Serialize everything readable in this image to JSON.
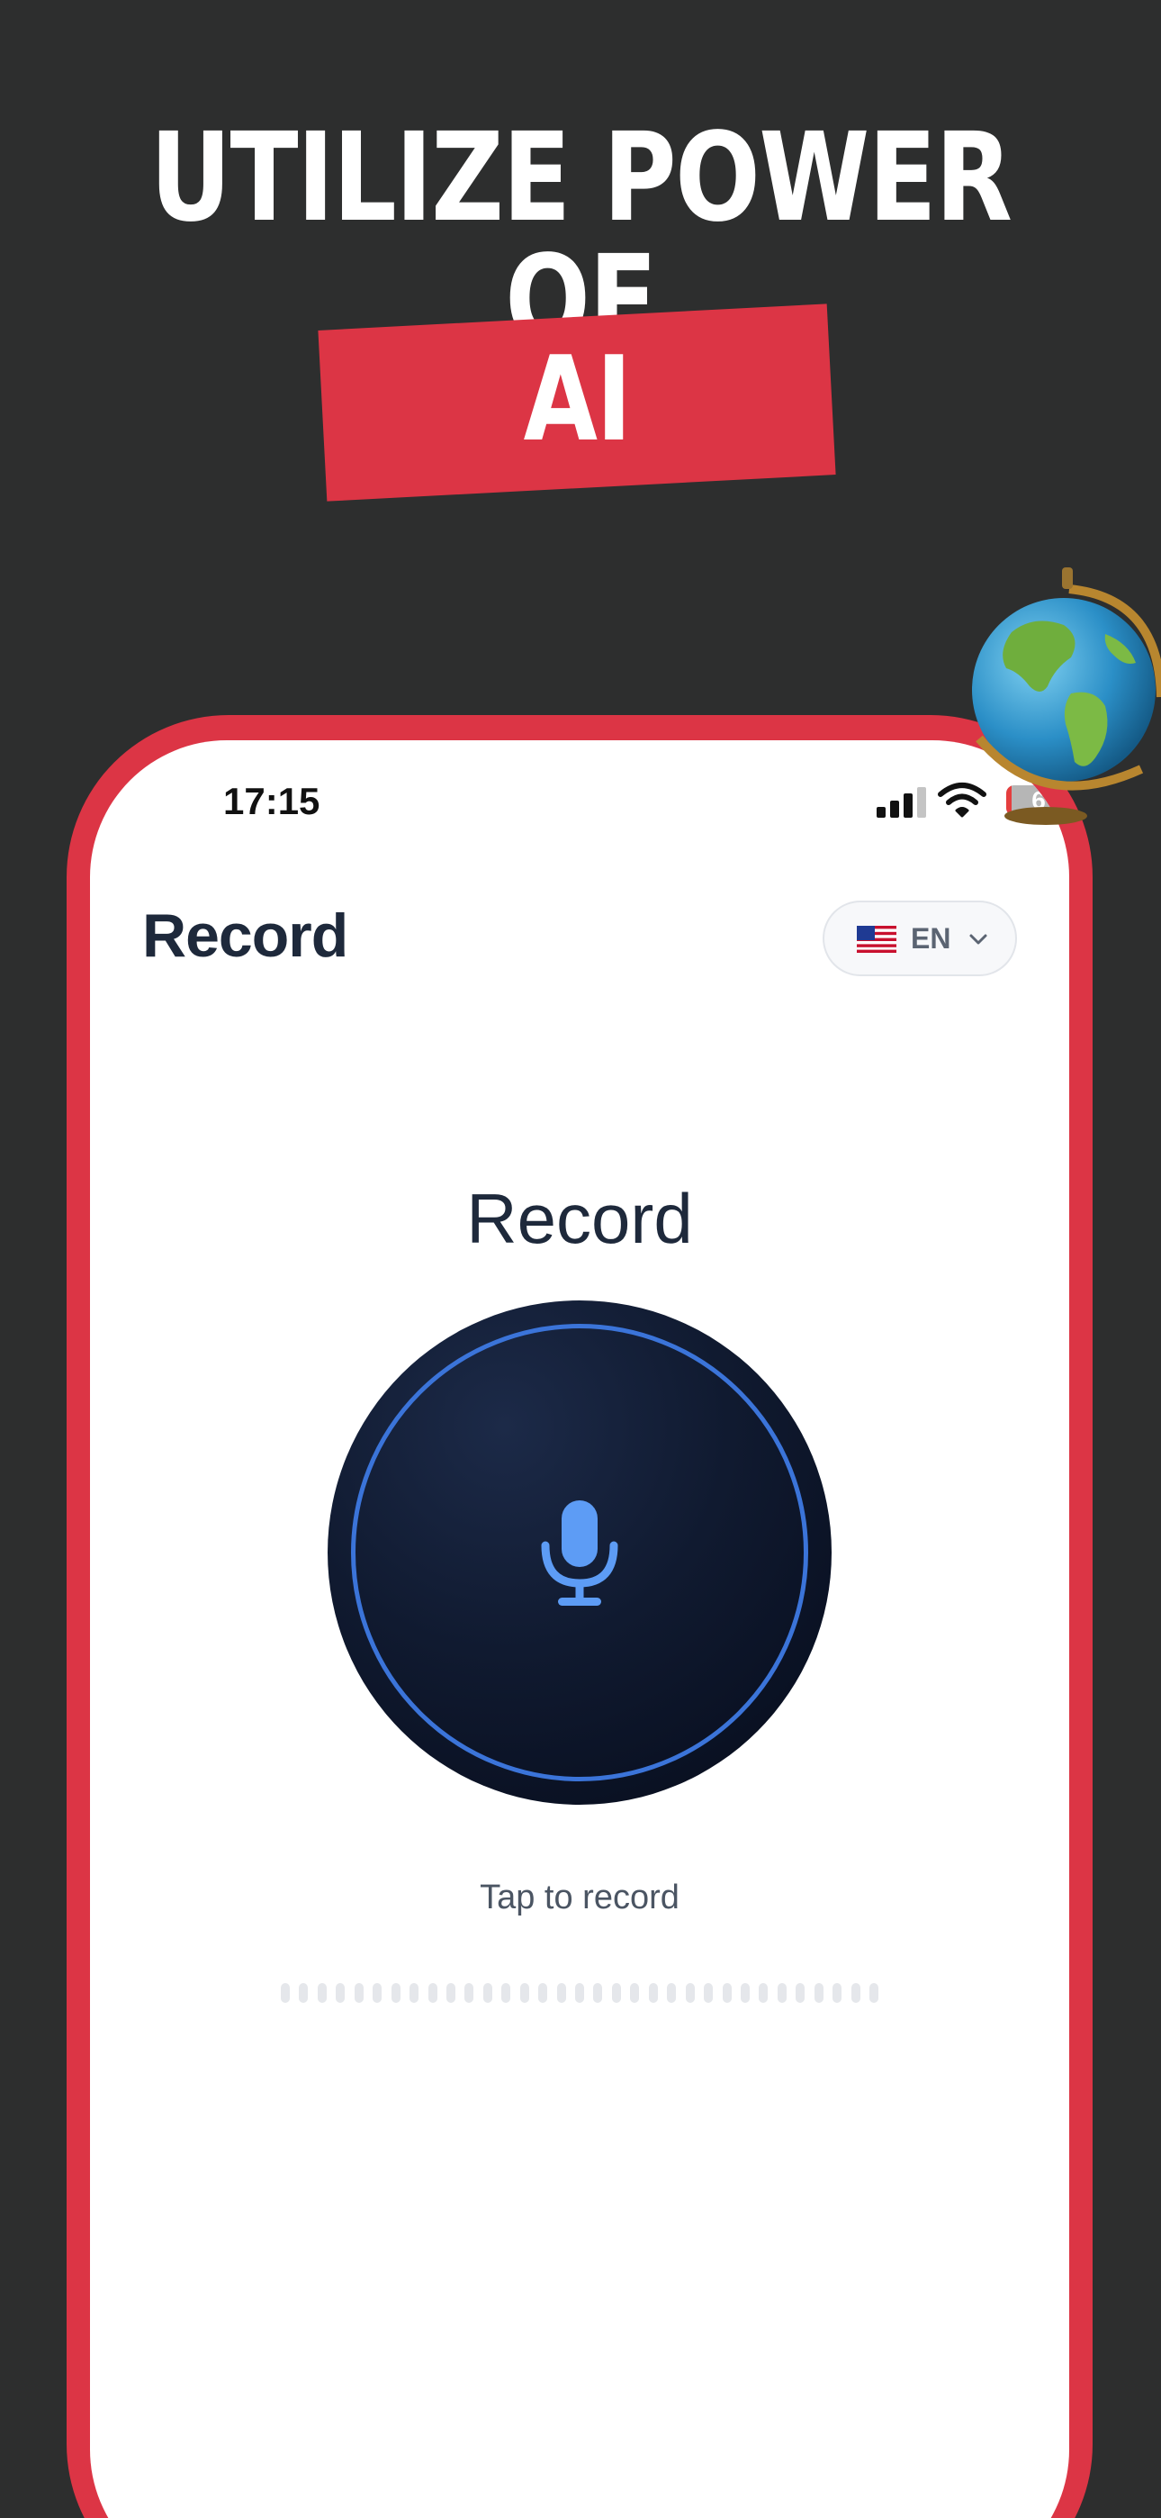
{
  "promo": {
    "headline": "UTILIZE POWER OF",
    "highlight": "AI",
    "accent_color": "#dc3545",
    "background_color": "#2d2e2e"
  },
  "status_bar": {
    "time": "17:15",
    "battery": "6"
  },
  "header": {
    "title": "Record",
    "language": {
      "flag": "us-flag-icon",
      "code": "EN"
    }
  },
  "recorder": {
    "label": "Record",
    "button_icon": "microphone-icon",
    "hint": "Tap to record",
    "ring_color": "#3b74d9"
  }
}
